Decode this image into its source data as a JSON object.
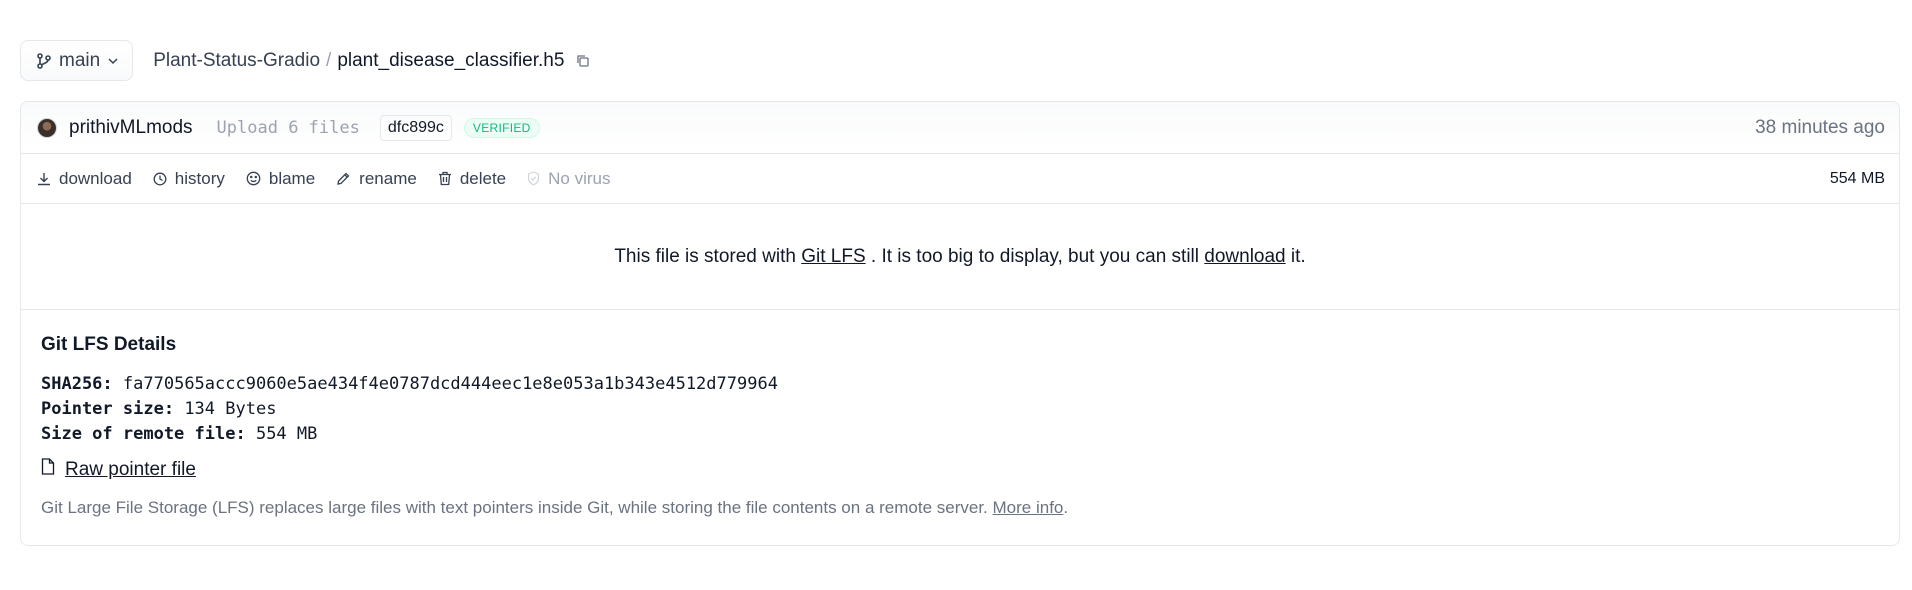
{
  "branch": {
    "label": "main"
  },
  "breadcrumb": {
    "repo": "Plant-Status-Gradio",
    "separator": "/",
    "file": "plant_disease_classifier.h5"
  },
  "commit": {
    "author": "prithivMLmods",
    "message": "Upload 6 files",
    "sha": "dfc899c",
    "verified_label": "VERIFIED",
    "time": "38 minutes ago"
  },
  "actions": {
    "download": "download",
    "history": "history",
    "blame": "blame",
    "rename": "rename",
    "delete": "delete",
    "virus": "No virus",
    "size": "554 MB"
  },
  "notice": {
    "before": "This file is stored with",
    "lfs_link": "Git LFS",
    "middle": ". It is too big to display, but you can still",
    "download_link": "download",
    "after": "it."
  },
  "details": {
    "title": "Git LFS Details",
    "sha_label": "SHA256:",
    "sha_value": "fa770565accc9060e5ae434f4e0787dcd444eec1e8e053a1b343e4512d779964",
    "pointer_label": "Pointer size:",
    "pointer_value": "134 Bytes",
    "remote_label": "Size of remote file:",
    "remote_value": "554 MB",
    "raw_link": "Raw pointer file",
    "description": "Git Large File Storage (LFS) replaces large files with text pointers inside Git, while storing the file contents on a remote server.",
    "more_info": "More info",
    "period": "."
  },
  "colors": {
    "verified_green": "#10b981",
    "muted": "#6b7280",
    "border": "#e5e7eb"
  }
}
